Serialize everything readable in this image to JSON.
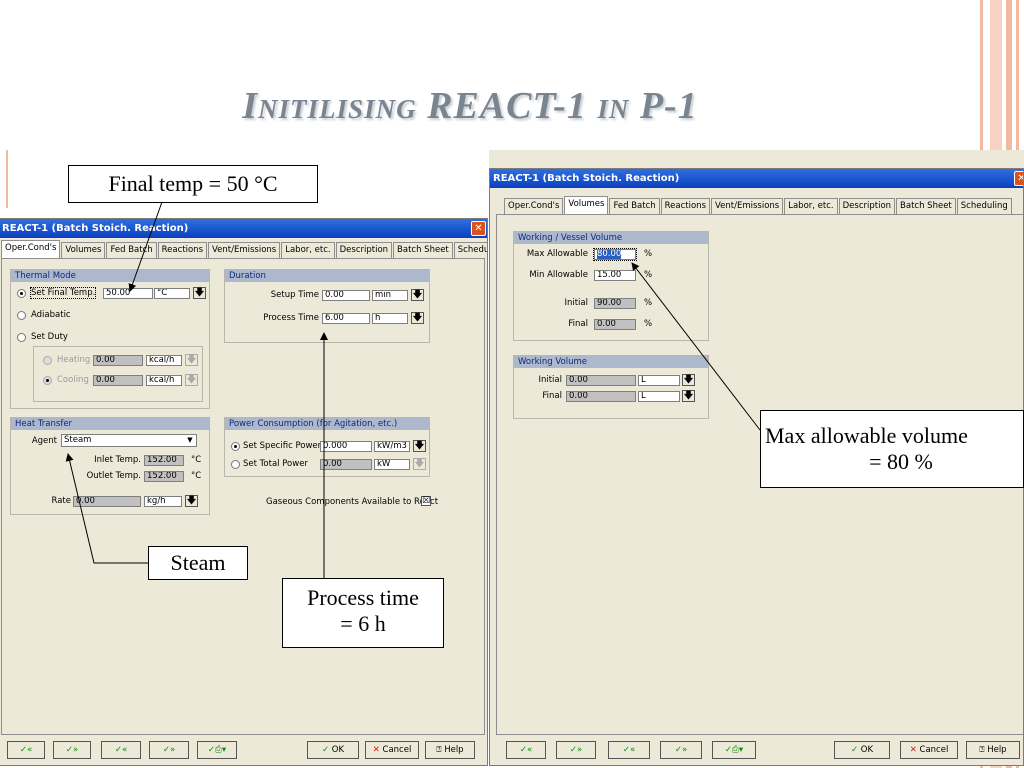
{
  "slide": {
    "title": "Initilising REACT-1 in P-1",
    "colors": {
      "title": "#7a8590",
      "stripe": "#f2b8a0",
      "titlebar": "#0a3fbf",
      "group_header": "#aeb8cc"
    }
  },
  "callouts": {
    "final_temp": "Final temp = 50 °C",
    "steam": "Steam",
    "process_time_l1": "Process time",
    "process_time_l2": "= 6 h",
    "max_vol_l1": "Max allowable volume",
    "max_vol_l2": "= 80 %"
  },
  "tabs": [
    "Oper.Cond's",
    "Volumes",
    "Fed Batch",
    "Reactions",
    "Vent/Emissions",
    "Labor, etc.",
    "Description",
    "Batch Sheet",
    "Scheduling"
  ],
  "left_dialog": {
    "title": "REACT-1 (Batch Stoich. Reaction)",
    "active_tab": "Oper.Cond's",
    "thermal_mode": {
      "header": "Thermal Mode",
      "set_final_temp": "Set Final Temp.",
      "final_temp_value": "50.00",
      "final_temp_unit": "°C",
      "adiabatic": "Adiabatic",
      "set_duty": "Set Duty",
      "heating": "Heating",
      "heating_value": "0.00",
      "heating_unit": "kcal/h",
      "cooling": "Cooling",
      "cooling_value": "0.00",
      "cooling_unit": "kcal/h"
    },
    "duration": {
      "header": "Duration",
      "setup_time_label": "Setup Time",
      "setup_time_value": "0.00",
      "setup_time_unit": "min",
      "process_time_label": "Process Time",
      "process_time_value": "6.00",
      "process_time_unit": "h"
    },
    "heat_transfer": {
      "header": "Heat Transfer",
      "agent_label": "Agent",
      "agent_value": "Steam",
      "inlet_label": "Inlet Temp.",
      "inlet_value": "152.00",
      "inlet_unit": "°C",
      "outlet_label": "Outlet Temp.",
      "outlet_value": "152.00",
      "outlet_unit": "°C",
      "rate_label": "Rate",
      "rate_value": "0.00",
      "rate_unit": "kg/h"
    },
    "power": {
      "header": "Power Consumption (for Agitation, etc.)",
      "specific_label": "Set Specific Power",
      "specific_value": "0.000",
      "specific_unit": "kW/m3",
      "total_label": "Set Total Power",
      "total_value": "0.00",
      "total_unit": "kW"
    },
    "gaseous_label": "Gaseous Components Available to React",
    "gaseous_check": "☒"
  },
  "right_dialog": {
    "title": "REACT-1 (Batch Stoich. Reaction)",
    "active_tab": "Volumes",
    "vessel_volume": {
      "header": "Working / Vessel Volume",
      "max_label": "Max Allowable",
      "max_value": "80.00",
      "min_label": "Min Allowable",
      "min_value": "15.00",
      "initial_label": "Initial",
      "initial_value": "90.00",
      "final_label": "Final",
      "final_value": "0.00",
      "unit": "%"
    },
    "working_volume": {
      "header": "Working Volume",
      "initial_label": "Initial",
      "initial_value": "0.00",
      "initial_unit": "L",
      "final_label": "Final",
      "final_value": "0.00",
      "final_unit": "L"
    }
  },
  "buttons": {
    "nav1": "✓«",
    "nav2": "✓»",
    "nav3": "✓«",
    "nav4": "✓»",
    "nav5": "✓⎙▾",
    "ok": "OK",
    "cancel": "Cancel",
    "help": "Help"
  },
  "icons": {
    "close": "close-icon",
    "dropdown": "chevron-down-icon",
    "ok": "checkmark-icon",
    "cancel": "x-icon",
    "help": "question-icon"
  }
}
